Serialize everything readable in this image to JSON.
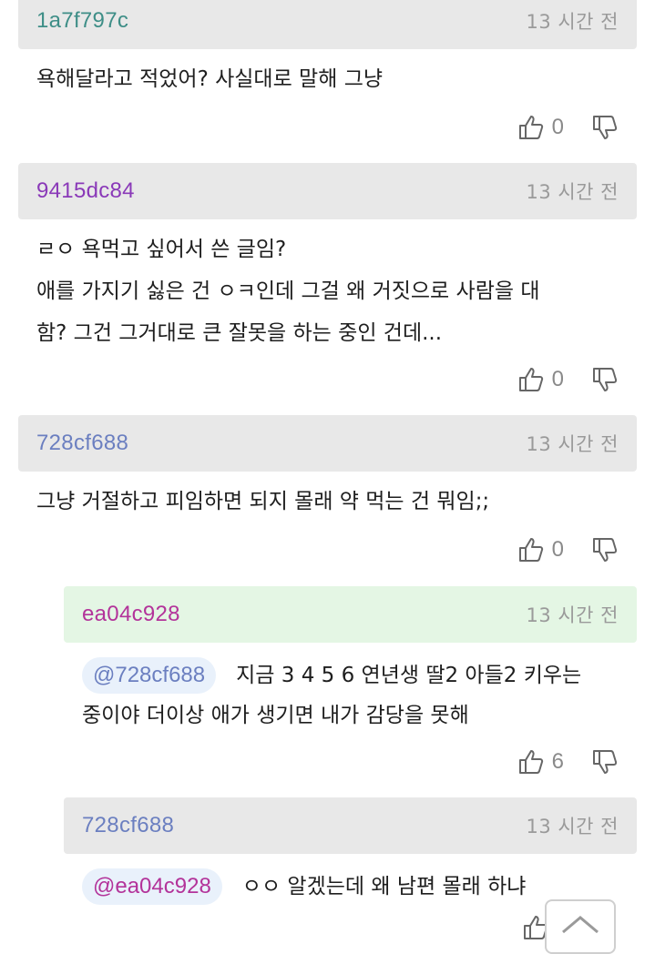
{
  "colors": {
    "header_gray": "#e8e8e8",
    "header_green": "#e4f6e4",
    "mention_bg": "#e9f1fb",
    "time_text": "#9a9a9a"
  },
  "comments": [
    {
      "author": "1a7f797c",
      "author_color": "#3e8e87",
      "time": "13 시간 전",
      "text": "욕해달라고 적었어? 사실대로 말해 그냥",
      "likes": "0"
    },
    {
      "author": "9415dc84",
      "author_color": "#8a39b8",
      "time": "13 시간 전",
      "text": "ㄹㅇ 욕먹고 싶어서 쓴 글임?\n애를 가지기 싫은 건 ㅇㅋ인데 그걸 왜 거짓으로 사람을 대\n함? 그건 그거대로 큰 잘못을 하는 중인 건데...",
      "likes": "0"
    },
    {
      "author": "728cf688",
      "author_color": "#6b7fc0",
      "time": "13 시간 전",
      "text": "그냥 거절하고 피임하면 되지 몰래 약 먹는 건 뭐임;;",
      "likes": "0"
    },
    {
      "author": "ea04c928",
      "author_color": "#b3339a",
      "time": "13 시간 전",
      "mention": "@728cf688",
      "mention_color": "#6b7fc0",
      "text": "지금 3 4 5 6 연년생 딸2 아들2 키우는\n중이야 더이상 애가 생기면 내가 감당을 못해",
      "likes": "6"
    },
    {
      "author": "728cf688",
      "author_color": "#6b7fc0",
      "time": "13 시간 전",
      "mention": "@ea04c928",
      "mention_color": "#b3339a",
      "text": "ㅇㅇ 알겠는데 왜 남편 몰래 하냐"
    }
  ]
}
